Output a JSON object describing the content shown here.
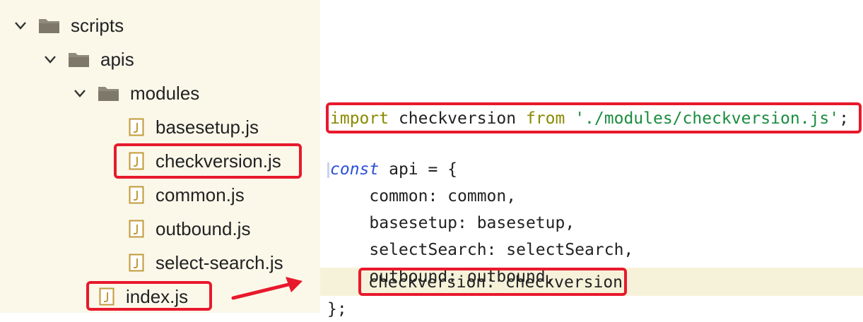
{
  "tree": {
    "items": [
      {
        "label": "scripts",
        "type": "folder",
        "expanded": true
      },
      {
        "label": "apis",
        "type": "folder",
        "expanded": true
      },
      {
        "label": "modules",
        "type": "folder",
        "expanded": true
      },
      {
        "label": "basesetup.js",
        "type": "file"
      },
      {
        "label": "checkversion.js",
        "type": "file",
        "highlighted": true
      },
      {
        "label": "common.js",
        "type": "file"
      },
      {
        "label": "outbound.js",
        "type": "file"
      },
      {
        "label": "select-search.js",
        "type": "file"
      },
      {
        "label": "index.js",
        "type": "file",
        "highlighted": true
      }
    ]
  },
  "code": {
    "import_kw": "import",
    "import_name": " checkversion ",
    "from_kw": "from",
    "import_path": " './modules/checkversion.js'",
    "import_semi": ";",
    "const_kw": "const",
    "const_rest": " api = {",
    "lines": [
      "    common: common,",
      "    basesetup: basesetup,",
      "    selectSearch: selectSearch,",
      "    outbound: outbound,"
    ],
    "highlight_line": "checkversion: checkversion",
    "close": "};"
  },
  "colors": {
    "tree_bg": "#fbf8ea",
    "highlight_border": "#e8192c",
    "folder": "#8f8a7a",
    "keyword_import": "#8a8a00",
    "keyword_const": "#2b4fd6",
    "string": "#1a8c3e",
    "current_line_bg": "#f6f2da"
  }
}
